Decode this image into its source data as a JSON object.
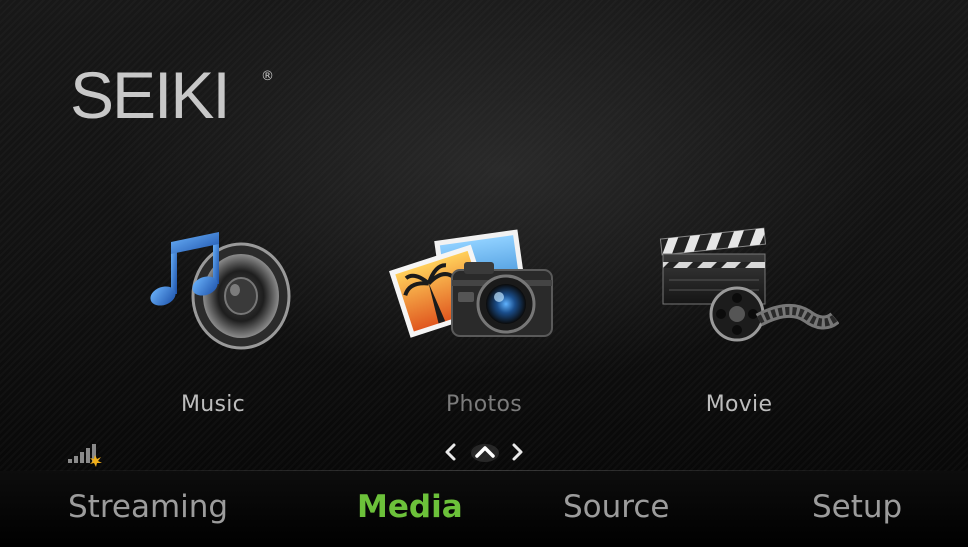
{
  "brand": {
    "name": "SEIKI",
    "registered_mark": "®"
  },
  "media_tiles": [
    {
      "label": "Music",
      "icon": "music-speaker-icon",
      "selected": false
    },
    {
      "label": "Photos",
      "icon": "photos-camera-icon",
      "selected": true
    },
    {
      "label": "Movie",
      "icon": "movie-clapper-icon",
      "selected": false
    }
  ],
  "status": {
    "network_icon": "network-signal-icon"
  },
  "pager": {
    "prev_icon": "chevron-left-icon",
    "up_icon": "chevron-up-icon",
    "next_icon": "chevron-right-icon"
  },
  "bottom_nav": {
    "items": [
      {
        "label": "Streaming",
        "active": false
      },
      {
        "label": "Media",
        "active": true
      },
      {
        "label": "Source",
        "active": false
      },
      {
        "label": "Setup",
        "active": false
      }
    ]
  },
  "colors": {
    "active_nav": "#6cc13a",
    "inactive_nav": "#9c9c9c",
    "background": "#111111"
  }
}
